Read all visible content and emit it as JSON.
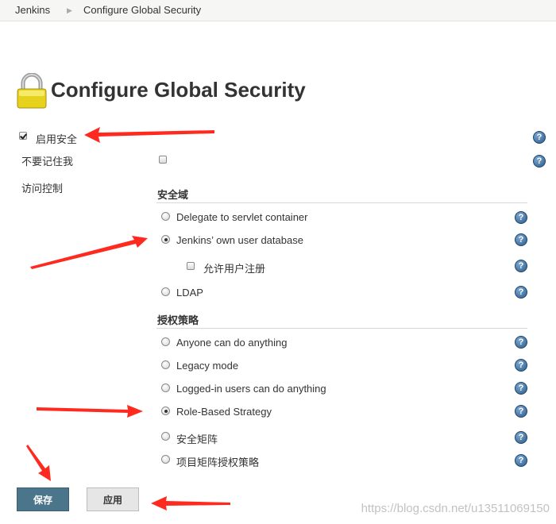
{
  "breadcrumb": {
    "home": "Jenkins",
    "separator_icon": "triangle-right-icon",
    "current": "Configure Global Security"
  },
  "page": {
    "title": "Configure Global Security",
    "icon": "lock-icon"
  },
  "settings": {
    "enable_security": {
      "label": "启用安全",
      "checked": true
    },
    "disable_remember_me": {
      "label": "不要记住我",
      "checked": false
    },
    "access_control_label": "访问控制"
  },
  "security_realm": {
    "heading": "安全域",
    "options": [
      {
        "label": "Delegate to servlet container",
        "selected": false
      },
      {
        "label": "Jenkins’ own user database",
        "selected": true
      },
      {
        "label": "LDAP",
        "selected": false
      }
    ],
    "allow_signup": {
      "label": "允许用户注册",
      "checked": false
    }
  },
  "authorization": {
    "heading": "授权策略",
    "options": [
      {
        "label": "Anyone can do anything",
        "selected": false
      },
      {
        "label": "Legacy mode",
        "selected": false
      },
      {
        "label": "Logged-in users can do anything",
        "selected": false
      },
      {
        "label": "Role-Based Strategy",
        "selected": true
      },
      {
        "label": "安全矩阵",
        "selected": false
      },
      {
        "label": "项目矩阵授权策略",
        "selected": false
      }
    ]
  },
  "buttons": {
    "save": "保存",
    "apply": "应用"
  },
  "help_icon": "question-mark-icon",
  "annotation_arrow_color": "#ff2a1f",
  "watermark": "https://blog.csdn.net/u13511069150"
}
